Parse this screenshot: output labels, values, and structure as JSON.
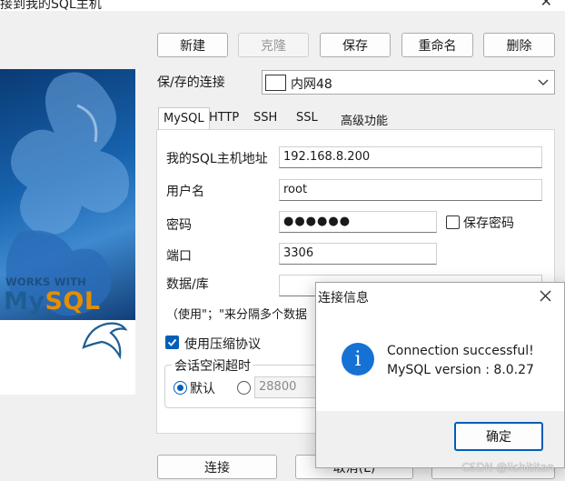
{
  "window": {
    "title": "接到我的SQL主机"
  },
  "toolbar": {
    "new_label": "新建",
    "clone_label": "克隆",
    "save_label": "保存",
    "rename_label": "重命名",
    "delete_label": "删除"
  },
  "saved_connection": {
    "label": "保/存的连接",
    "value": "内网48"
  },
  "tabs": [
    {
      "label": "MySQL",
      "active": true
    },
    {
      "label": "HTTP"
    },
    {
      "label": "SSH"
    },
    {
      "label": "SSL"
    },
    {
      "label": "高级功能"
    }
  ],
  "form": {
    "host_label": "我的SQL主机地址",
    "host_value": "192.168.8.200",
    "user_label": "用户名",
    "user_value": "root",
    "password_label": "密码",
    "password_value": "●●●●●●",
    "save_password_label": "保存密码",
    "port_label": "端口",
    "port_value": "3306",
    "database_label": "数据/库",
    "database_value": "",
    "hint_text": "（使用\"；\"来分隔多个数据",
    "compression_label": "使用压缩协议",
    "compression_checked": true,
    "timeout_group_label": "会话空闲超时",
    "timeout_default_label": "默认",
    "timeout_custom_value": "28800"
  },
  "footer": {
    "connect_label": "连接",
    "cancel_label": "取消(L)"
  },
  "logo": {
    "works_with": "WORKS WITH",
    "mysql_my": "My",
    "mysql_sql": "SQL"
  },
  "dialog": {
    "title": "连接信息",
    "line1": "Connection successful!",
    "line2": "MySQL version : 8.0.27",
    "ok_label": "确定"
  },
  "watermark": "CSDN @lishititan",
  "colors": {
    "accent": "#005fb8",
    "info_icon": "#1671d4",
    "mysql_blue": "#1e5e95",
    "mysql_orange": "#e48e00"
  }
}
